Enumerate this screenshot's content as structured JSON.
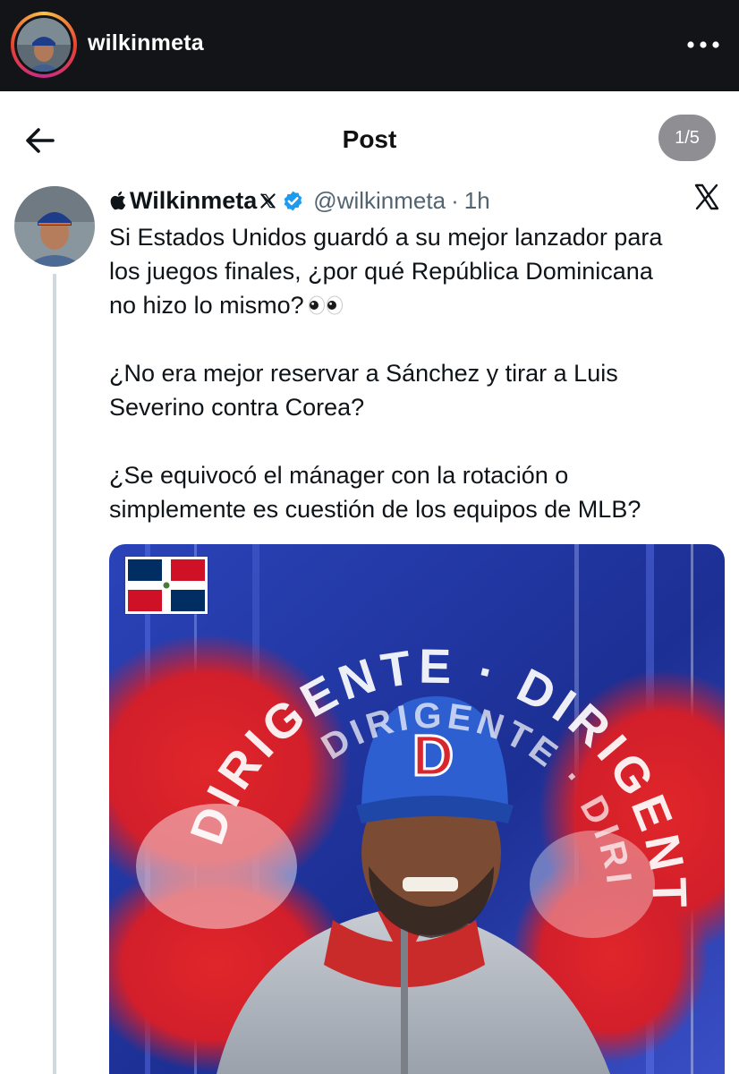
{
  "instagram": {
    "username": "wilkinmeta",
    "avatar_icon": "profile-photo",
    "more_icon": "more-dots-icon"
  },
  "post_header": {
    "title": "Post",
    "page_indicator": "1/5",
    "back_icon": "back-arrow-icon"
  },
  "tweet": {
    "display_name": "Wilkinmeta",
    "handle": "@wilkinmeta",
    "separator": "·",
    "time": "1h",
    "verified": true,
    "paragraphs": [
      [
        "Si Estados Unidos guardó a su mejor lanzador para",
        "los juegos finales, ¿por qué República Dominicana",
        "no hizo lo mismo?"
      ],
      [
        "¿No era mejor reservar a Sánchez y tirar a Luis",
        "Severino contra Corea?"
      ],
      [
        " ¿Se equivocó el mánager con la rotación o",
        "simplemente es cuestión de los equipos de MLB?"
      ]
    ],
    "emoji": "eyes-emoji"
  },
  "media": {
    "ring_text": "DIRIGENTE",
    "cap_logo": "D",
    "flag": "dominican-republic-flag"
  },
  "colors": {
    "ig_bar": "#121418",
    "verified_blue": "#1d9bf0",
    "text_primary": "#0f1419",
    "text_secondary": "#536471",
    "thread_line": "#cfd9de",
    "pill": "#8f8f93",
    "flag_red": "#ce1126",
    "flag_blue": "#002d62"
  }
}
